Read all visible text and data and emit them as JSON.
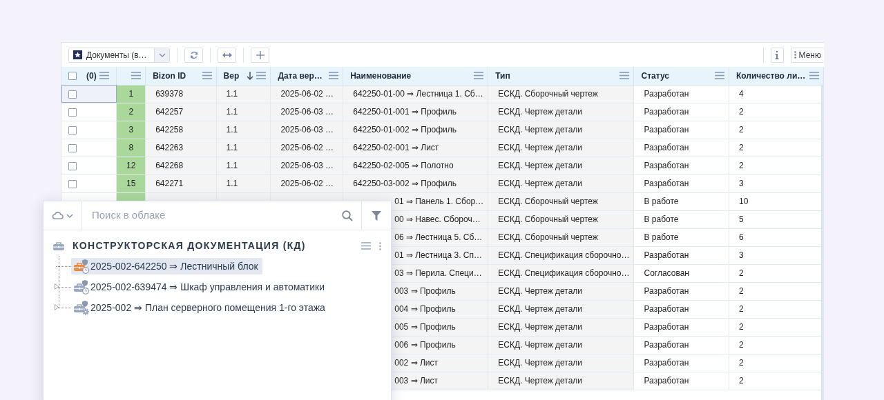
{
  "toolbar": {
    "view_select": "Документы (в…",
    "menu_button": "Меню"
  },
  "table": {
    "columns": [
      {
        "kind": "select",
        "label": "(0)",
        "sorted": false,
        "checked": false
      },
      {
        "kind": "index",
        "sorted": false
      },
      {
        "kind": "text",
        "label": "Bizon ID",
        "sorted": false
      },
      {
        "kind": "text",
        "label": "Вер",
        "sorted": true
      },
      {
        "kind": "text",
        "label": "Дата вер…",
        "sorted": false
      },
      {
        "kind": "text",
        "label": "Наименование",
        "sorted": false
      },
      {
        "kind": "text",
        "label": "Тип",
        "sorted": false
      },
      {
        "kind": "text",
        "label": "Статус",
        "sorted": false
      },
      {
        "kind": "text",
        "label": "Количество ли…",
        "sorted": false
      }
    ],
    "rows": [
      {
        "kind": "full",
        "selected": true,
        "checked": false,
        "number": "1",
        "bizon_id": "639378",
        "version": "1.1",
        "date": "2025-06-02 …",
        "name": "642250-01-00 ⇒ Лестница 1. Сб…",
        "type": "ЕСКД. Сборочный чертеж",
        "status": "Разработан",
        "sheets": "4"
      },
      {
        "kind": "full",
        "selected": false,
        "checked": false,
        "number": "2",
        "bizon_id": "642257",
        "version": "1.1",
        "date": "2025-06-03 …",
        "name": "642250-01-001 ⇒ Профиль",
        "type": "ЕСКД. Чертеж детали",
        "status": "Разработан",
        "sheets": "2"
      },
      {
        "kind": "full",
        "selected": false,
        "checked": false,
        "number": "3",
        "bizon_id": "642258",
        "version": "1.1",
        "date": "2025-06-03 …",
        "name": "642250-01-002 ⇒ Профиль",
        "type": "ЕСКД. Чертеж детали",
        "status": "Разработан",
        "sheets": "2"
      },
      {
        "kind": "full",
        "selected": false,
        "checked": false,
        "number": "8",
        "bizon_id": "642263",
        "version": "1.1",
        "date": "2025-06-02 …",
        "name": "642250-02-001 ⇒ Лист",
        "type": "ЕСКД. Чертеж детали",
        "status": "Разработан",
        "sheets": "2"
      },
      {
        "kind": "full",
        "selected": false,
        "checked": false,
        "number": "12",
        "bizon_id": "642268",
        "version": "1.1",
        "date": "2025-06-03 …",
        "name": "642250-02-005 ⇒ Полотно",
        "type": "ЕСКД. Чертеж детали",
        "status": "Разработан",
        "sheets": "2"
      },
      {
        "kind": "full",
        "selected": false,
        "checked": false,
        "number": "15",
        "bizon_id": "642271",
        "version": "1.1",
        "date": "2025-06-02 …",
        "name": "642250-03-002 ⇒ Профиль",
        "type": "ЕСКД. Чертеж детали",
        "status": "Разработан",
        "sheets": "3"
      },
      {
        "kind": "covered",
        "name": "01 ⇒ Панель 1. Сбор…",
        "type": "ЕСКД. Сборочный чертеж",
        "status": "В работе",
        "sheets": "10"
      },
      {
        "kind": "covered",
        "name": "00 ⇒ Навес. Сбороч…",
        "type": "ЕСКД. Сборочный чертеж",
        "status": "В работе",
        "sheets": "5"
      },
      {
        "kind": "covered",
        "name": "06 ⇒ Лестница 5. Сб…",
        "type": "ЕСКД. Сборочный чертеж",
        "status": "В работе",
        "sheets": "6"
      },
      {
        "kind": "covered",
        "name": "01 ⇒ Лестница 3. Сп…",
        "type": "ЕСКД. Спецификация сборочно…",
        "status": "Разработан",
        "sheets": "3"
      },
      {
        "kind": "covered",
        "name": "03 ⇒ Перила. Специ…",
        "type": "ЕСКД. Спецификация сборочно…",
        "status": "Согласован",
        "sheets": "2"
      },
      {
        "kind": "covered",
        "name": "003 ⇒ Профиль",
        "type": "ЕСКД. Чертеж детали",
        "status": "Разработан",
        "sheets": "2"
      },
      {
        "kind": "covered",
        "name": "004 ⇒ Профиль",
        "type": "ЕСКД. Чертеж детали",
        "status": "Разработан",
        "sheets": "2"
      },
      {
        "kind": "covered",
        "name": "005 ⇒ Профиль",
        "type": "ЕСКД. Чертеж детали",
        "status": "Разработан",
        "sheets": "2"
      },
      {
        "kind": "covered",
        "name": "006 ⇒ Профиль",
        "type": "ЕСКД. Чертеж детали",
        "status": "Разработан",
        "sheets": "2"
      },
      {
        "kind": "covered",
        "name": "002 ⇒ Лист",
        "type": "ЕСКД. Чертеж детали",
        "status": "Разработан",
        "sheets": "2"
      },
      {
        "kind": "covered",
        "name": "003 ⇒ Лист",
        "type": "ЕСКД. Чертеж детали",
        "status": "Разработан",
        "sheets": "2"
      }
    ]
  },
  "cloud_panel": {
    "search": {
      "placeholder": "Поиск в облаке"
    },
    "tree": {
      "title": "КОНСТРУКТОРСКАЯ ДОКУМЕНТАЦИЯ (КД)",
      "items": [
        {
          "label": "2025-002-642250 ⇒ Лестничный блок",
          "selected": true,
          "expandable": false,
          "color": "#f0883e",
          "kind": "clock"
        },
        {
          "label": "2025-002-639474 ⇒ Шкаф управления и автоматики",
          "selected": false,
          "expandable": true,
          "color": "#9aa8c2",
          "kind": "clock"
        },
        {
          "label": "2025-002 ⇒ План серверного помещения 1-го этажа",
          "selected": false,
          "expandable": true,
          "color": "#9aa8c2",
          "kind": "gear"
        }
      ]
    }
  }
}
